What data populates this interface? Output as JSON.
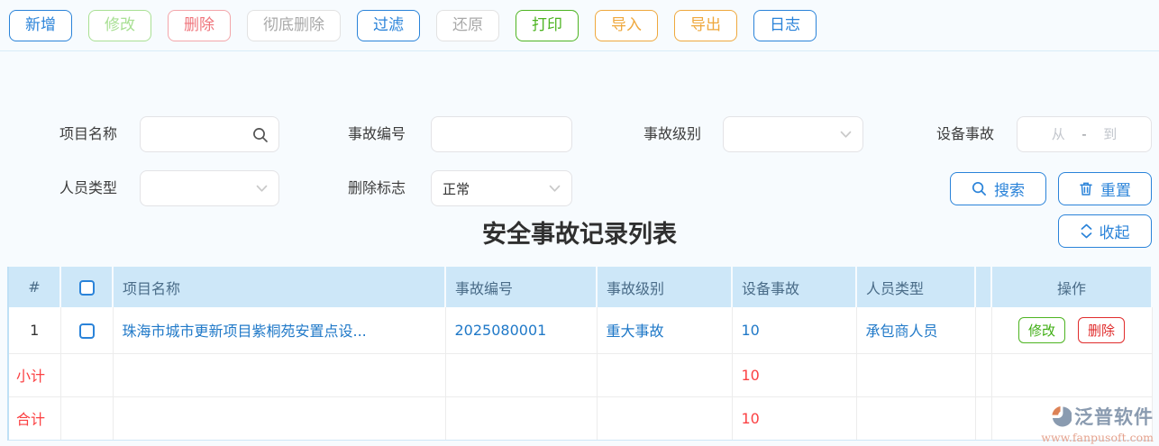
{
  "colors": {
    "primary_blue": "#2a83d9",
    "green": "#4db421",
    "orange": "#efa83d",
    "red_accent": "#fb4143",
    "data_blue": "#2079c8",
    "header_bg": "#cde7f8",
    "header_text": "#4a6c88"
  },
  "toolbar": {
    "buttons": [
      {
        "label": "新增",
        "variant": "blue"
      },
      {
        "label": "修改",
        "variant": "light-green"
      },
      {
        "label": "删除",
        "variant": "light-red"
      },
      {
        "label": "彻底删除",
        "variant": "gray"
      },
      {
        "label": "过滤",
        "variant": "blue"
      },
      {
        "label": "还原",
        "variant": "gray"
      },
      {
        "label": "打印",
        "variant": "green"
      },
      {
        "label": "导入",
        "variant": "orange"
      },
      {
        "label": "导出",
        "variant": "orange"
      },
      {
        "label": "日志",
        "variant": "blue"
      }
    ]
  },
  "filters": {
    "project_name": {
      "label": "项目名称",
      "value": ""
    },
    "accident_no": {
      "label": "事故编号",
      "value": ""
    },
    "accident_level": {
      "label": "事故级别",
      "value": ""
    },
    "equipment_accident": {
      "label": "设备事故",
      "from_placeholder": "从",
      "separator": "-",
      "to_placeholder": "到"
    },
    "personnel_type": {
      "label": "人员类型",
      "value": ""
    },
    "delete_flag": {
      "label": "删除标志",
      "value": "正常"
    },
    "search_button": "搜索",
    "reset_button": "重置",
    "collapse_button": "收起"
  },
  "list": {
    "title": "安全事故记录列表",
    "headers": {
      "index": "#",
      "project_name": "项目名称",
      "accident_no": "事故编号",
      "accident_level": "事故级别",
      "equipment_accident": "设备事故",
      "personnel_type": "人员类型",
      "actions": "操作"
    },
    "rows": [
      {
        "index": "1",
        "project_name": "珠海市城市更新项目紫桐苑安置点设...",
        "accident_no": "2025080001",
        "accident_level": "重大事故",
        "equipment_accident": "10",
        "personnel_type": "承包商人员",
        "edit_label": "修改",
        "delete_label": "删除"
      }
    ],
    "subtotal": {
      "label": "小计",
      "equipment_accident": "10"
    },
    "total": {
      "label": "合计",
      "equipment_accident": "10"
    }
  },
  "watermark": {
    "brand": "泛普软件",
    "url": "www.fanpusoft.com"
  }
}
